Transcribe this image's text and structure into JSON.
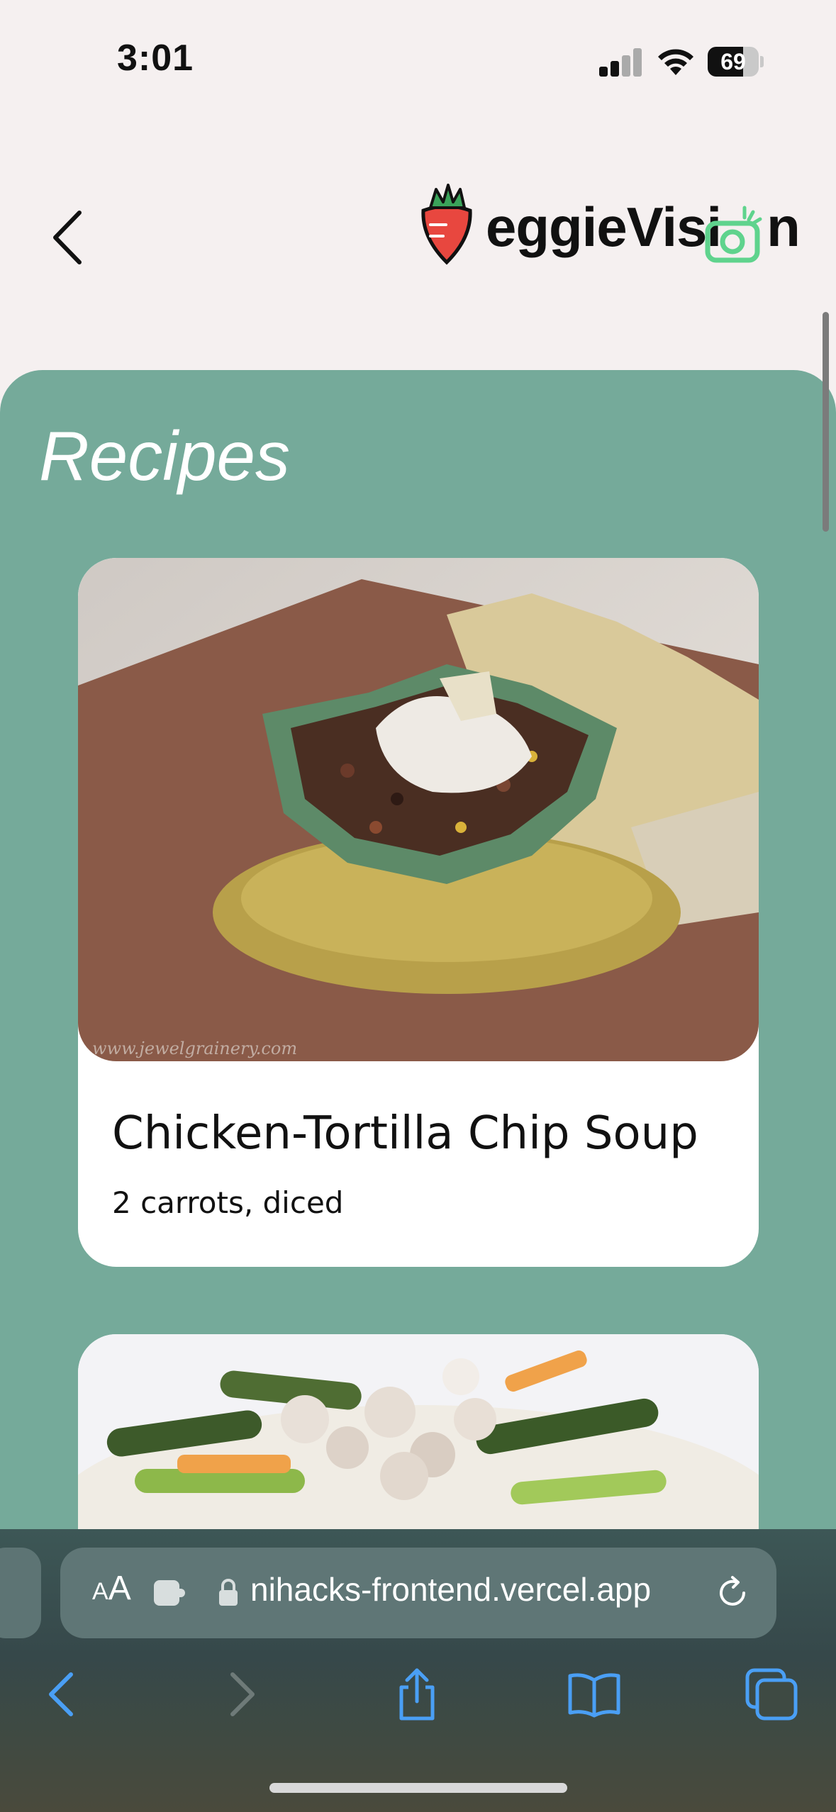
{
  "status_bar": {
    "time": "3:01",
    "battery_percent": "69",
    "battery_level": 0.69
  },
  "header": {
    "logo_text_prefix": "eggie",
    "logo_text_vision": "Visi",
    "logo_text_suffix": "n",
    "logo_alt": "VeggieVision"
  },
  "main": {
    "title": "Recipes",
    "recipes": [
      {
        "title": "Chicken-Tortilla Chip Soup",
        "subtitle": "2 carrots, diced"
      }
    ]
  },
  "browser": {
    "url": "nihacks-frontend.vercel.app",
    "text_size_label_small": "A",
    "text_size_label_large": "A"
  },
  "colors": {
    "panel": "#75aa9a",
    "background": "#f5f0f0",
    "logo_red": "#e8473f",
    "logo_green": "#5fd38d",
    "safari_blue": "#4a9ff5"
  }
}
